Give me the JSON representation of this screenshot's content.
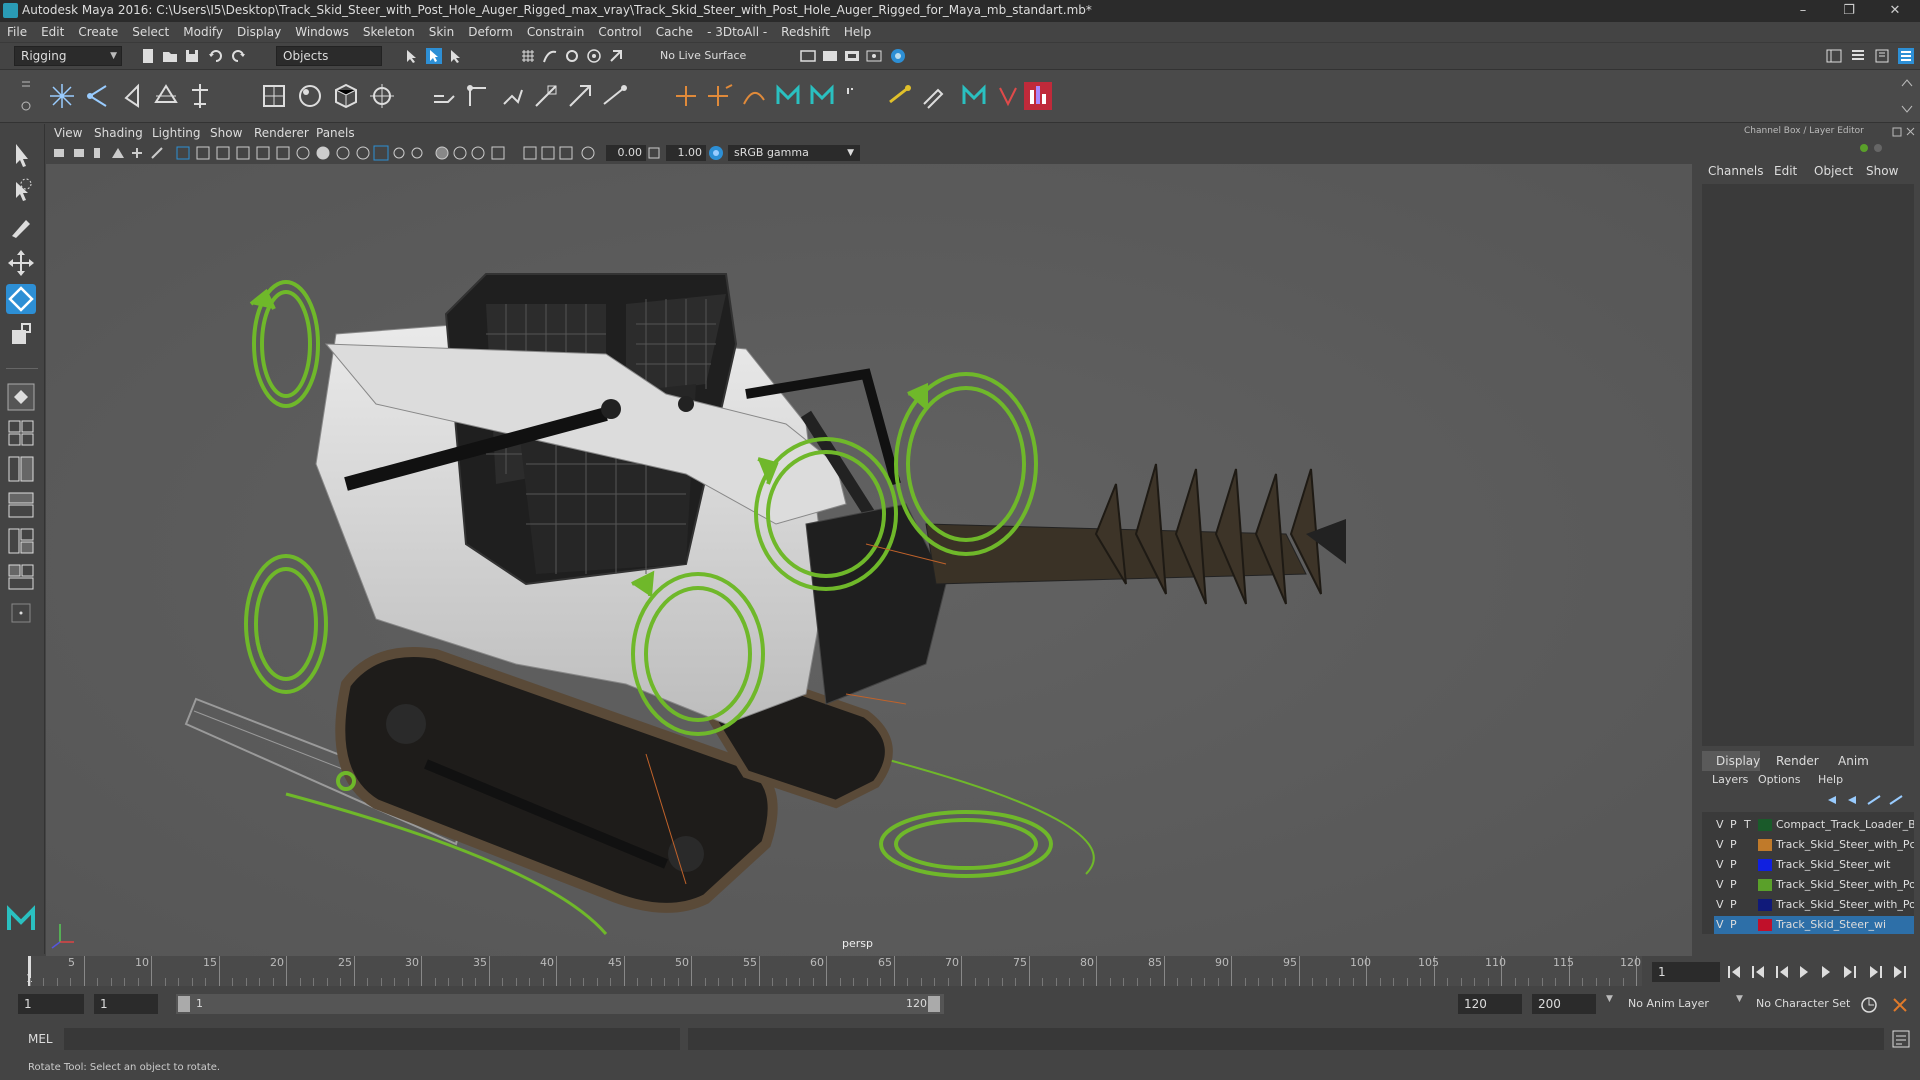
{
  "window": {
    "title": "Autodesk Maya 2016: C:\\Users\\I5\\Desktop\\Track_Skid_Steer_with_Post_Hole_Auger_Rigged_max_vray\\Track_Skid_Steer_with_Post_Hole_Auger_Rigged_for_Maya_mb_standart.mb*",
    "minimize": "–",
    "restore": "❐",
    "close": "✕"
  },
  "menubar": [
    "File",
    "Edit",
    "Create",
    "Select",
    "Modify",
    "Display",
    "Windows",
    "Skeleton",
    "Skin",
    "Deform",
    "Constrain",
    "Control",
    "Cache",
    "- 3DtoAll -",
    "Redshift",
    "Help"
  ],
  "statusline": {
    "mode": "Rigging",
    "selection_mode": "Objects",
    "live_surface": "No Live Surface"
  },
  "viewport": {
    "menus": [
      "View",
      "Shading",
      "Lighting",
      "Show",
      "Renderer",
      "Panels"
    ],
    "exposure": "0.00",
    "gamma": "1.00",
    "color_space": "sRGB gamma",
    "camera_label": "persp"
  },
  "channelbox": {
    "header": "Channel Box / Layer Editor",
    "menus": [
      "Channels",
      "Edit",
      "Object",
      "Show"
    ],
    "layer_tabs": [
      "Display",
      "Render",
      "Anim"
    ],
    "layer_menus": [
      "Layers",
      "Options",
      "Help"
    ],
    "layers": [
      {
        "v": "V",
        "p": "P",
        "t": "T",
        "color": "#1a5a2a",
        "name": "Compact_Track_Loader_Bo",
        "selected": false
      },
      {
        "v": "V",
        "p": "P",
        "t": "",
        "color": "#c07a2a",
        "name": "Track_Skid_Steer_with_Pc",
        "selected": false
      },
      {
        "v": "V",
        "p": "P",
        "t": "",
        "color": "#1020e0",
        "name": "Track_Skid_Steer_wit",
        "selected": false
      },
      {
        "v": "V",
        "p": "P",
        "t": "",
        "color": "#5aa02a",
        "name": "Track_Skid_Steer_with_Pos",
        "selected": false
      },
      {
        "v": "V",
        "p": "P",
        "t": "",
        "color": "#101a7a",
        "name": "Track_Skid_Steer_with_Pos",
        "selected": false
      },
      {
        "v": "V",
        "p": "P",
        "t": "",
        "color": "#c0102a",
        "name": "Track_Skid_Steer_wi",
        "selected": true
      }
    ]
  },
  "timeline": {
    "ticks": [
      "5",
      "10",
      "15",
      "20",
      "25",
      "30",
      "35",
      "40",
      "45",
      "50",
      "55",
      "60",
      "65",
      "70",
      "75",
      "80",
      "85",
      "90",
      "95",
      "100",
      "105",
      "110",
      "115",
      "120"
    ],
    "start_marker": "1",
    "current_frame": "1"
  },
  "range": {
    "start": "1",
    "playback_start": "1",
    "slider_start": "1",
    "slider_end": "120",
    "playback_end": "120",
    "end": "200",
    "anim_layer": "No Anim Layer",
    "character_set": "No Character Set"
  },
  "command": {
    "language": "MEL"
  },
  "helpline": "Rotate Tool: Select an object to rotate.",
  "colors": {
    "control_green": "#6fb82a",
    "body_white": "#d9d9d9",
    "accent_blue": "#2d8fd5",
    "viewport_bg": "#5d5d5d"
  }
}
